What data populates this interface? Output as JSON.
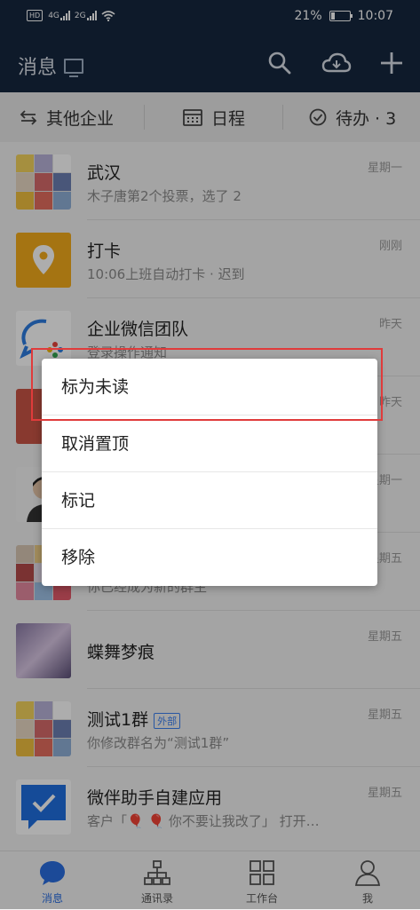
{
  "status_bar": {
    "hd": "HD",
    "net1": "4G",
    "net2": "2G",
    "battery": "21%",
    "time": "10:07"
  },
  "header": {
    "title": "消息"
  },
  "subbar": {
    "other_corp": "其他企业",
    "schedule": "日程",
    "todo": "待办 · 3"
  },
  "conversations": [
    {
      "name": "武汉",
      "preview": "木子唐第2个投票，选了 2",
      "time": "星期一"
    },
    {
      "name": "打卡",
      "preview": "10:06上班自动打卡 · 迟到",
      "time": "刚刚"
    },
    {
      "name": "企业微信团队",
      "preview": "登录操作通知",
      "time": "昨天"
    },
    {
      "name": "",
      "preview": "",
      "time": "昨天"
    },
    {
      "name": "",
      "preview": "",
      "time": "星期一"
    },
    {
      "name": "",
      "preview": "你已经成为新的群主",
      "time": "星期五"
    },
    {
      "name": "蝶舞梦痕",
      "preview": "",
      "time": "星期五"
    },
    {
      "name": "测试1群",
      "tag": "外部",
      "preview": "你修改群名为“测试1群”",
      "time": "星期五"
    },
    {
      "name": "微伴助手自建应用",
      "preview": "客户「🎈 🎈 你不要让我改了」 打开…",
      "time": "星期五"
    }
  ],
  "context_menu": {
    "items": [
      "标为未读",
      "取消置顶",
      "标记",
      "移除"
    ]
  },
  "tabs": [
    {
      "label": "消息",
      "icon": "chat-icon"
    },
    {
      "label": "通讯录",
      "icon": "org-chart-icon"
    },
    {
      "label": "工作台",
      "icon": "grid-icon"
    },
    {
      "label": "我",
      "icon": "person-icon"
    }
  ],
  "colors": {
    "header_bg": "#15273f",
    "accent": "#2a6ee0",
    "highlight_box": "#e03b3b",
    "tag_blue": "#3a7ff0"
  }
}
